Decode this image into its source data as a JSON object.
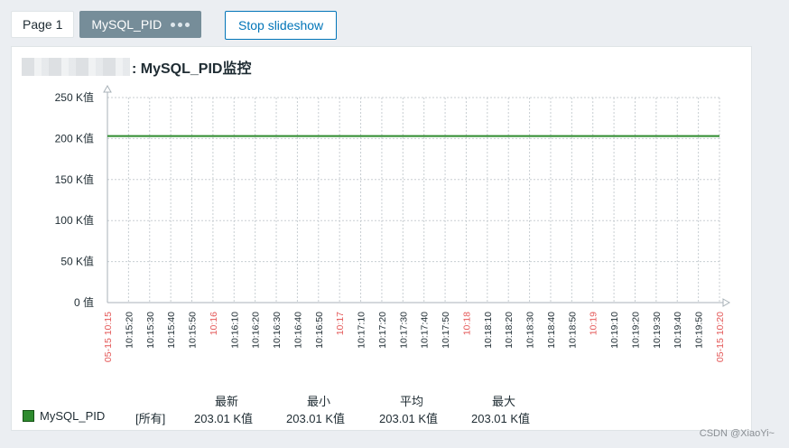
{
  "tabs": [
    {
      "label": "Page 1"
    },
    {
      "label": "MySQL_PID"
    }
  ],
  "controls": {
    "stop_label": "Stop slideshow"
  },
  "widget": {
    "title": ": MySQL_PID监控"
  },
  "chart_data": {
    "type": "line",
    "y_ticks": [
      "250 K值",
      "200 K值",
      "150 K值",
      "100 K值",
      "50 K值",
      "0 值"
    ],
    "ylim": [
      0,
      250000
    ],
    "x_labels": [
      "05-15 10:15",
      "10:15:20",
      "10:15:30",
      "10:15:40",
      "10:15:50",
      "10:16",
      "10:16:10",
      "10:16:20",
      "10:16:30",
      "10:16:40",
      "10:16:50",
      "10:17",
      "10:17:10",
      "10:17:20",
      "10:17:30",
      "10:17:40",
      "10:17:50",
      "10:18",
      "10:18:10",
      "10:18:20",
      "10:18:30",
      "10:18:40",
      "10:18:50",
      "10:19",
      "10:19:10",
      "10:19:20",
      "10:19:30",
      "10:19:40",
      "10:19:50",
      "05-15 10:20"
    ],
    "x_label_highlight": [
      true,
      false,
      false,
      false,
      false,
      true,
      false,
      false,
      false,
      false,
      false,
      true,
      false,
      false,
      false,
      false,
      false,
      true,
      false,
      false,
      false,
      false,
      false,
      true,
      false,
      false,
      false,
      false,
      false,
      true
    ],
    "series": [
      {
        "name": "MySQL_PID",
        "color": "#2e8b2e",
        "values": [
          203010,
          203010
        ]
      }
    ],
    "grid": true
  },
  "legend": {
    "headers": {
      "last": "最新",
      "min": "最小",
      "avg": "平均",
      "max": "最大"
    },
    "rows": [
      {
        "name": "MySQL_PID",
        "scope": "[所有]",
        "last": "203.01 K值",
        "min": "203.01 K值",
        "avg": "203.01 K值",
        "max": "203.01 K值"
      }
    ]
  },
  "footer": {
    "watermark": "CSDN @XiaoYi~"
  }
}
